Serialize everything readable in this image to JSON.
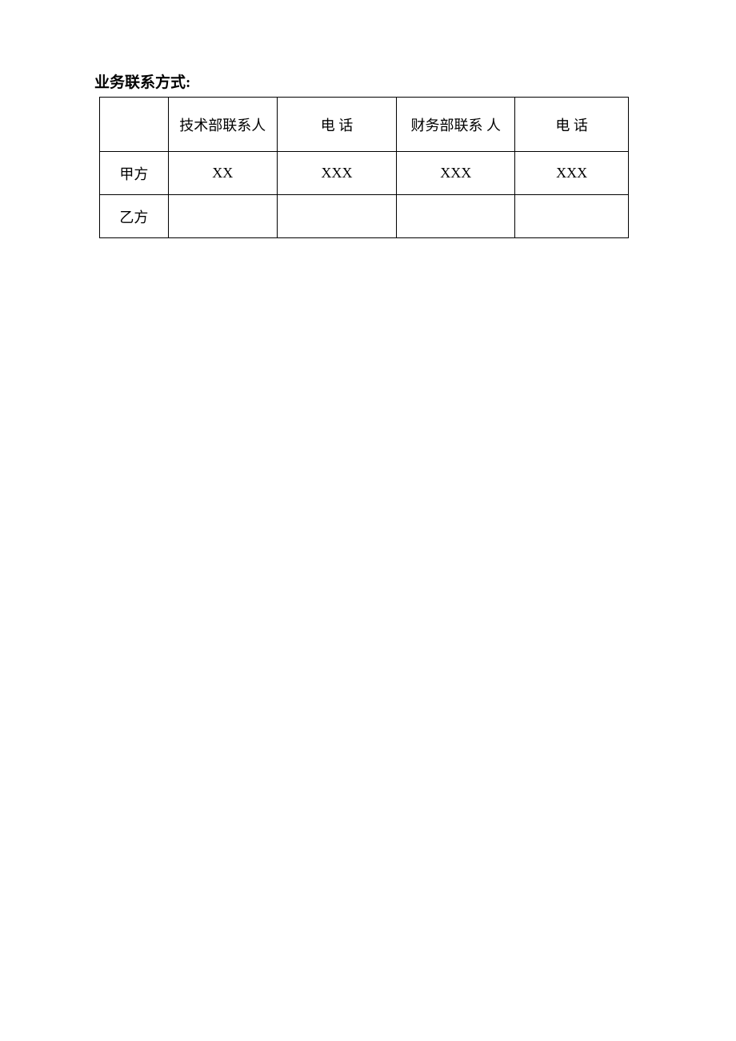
{
  "title": "业务联系方式:",
  "table": {
    "headers": [
      "",
      "技术部联系人",
      "电 话",
      "财务部联系 人",
      "电 话"
    ],
    "rows": [
      {
        "label": "甲方",
        "cells": [
          "XX",
          "XXX",
          "XXX",
          "XXX"
        ]
      },
      {
        "label": "乙方",
        "cells": [
          "",
          "",
          "",
          ""
        ]
      }
    ]
  }
}
